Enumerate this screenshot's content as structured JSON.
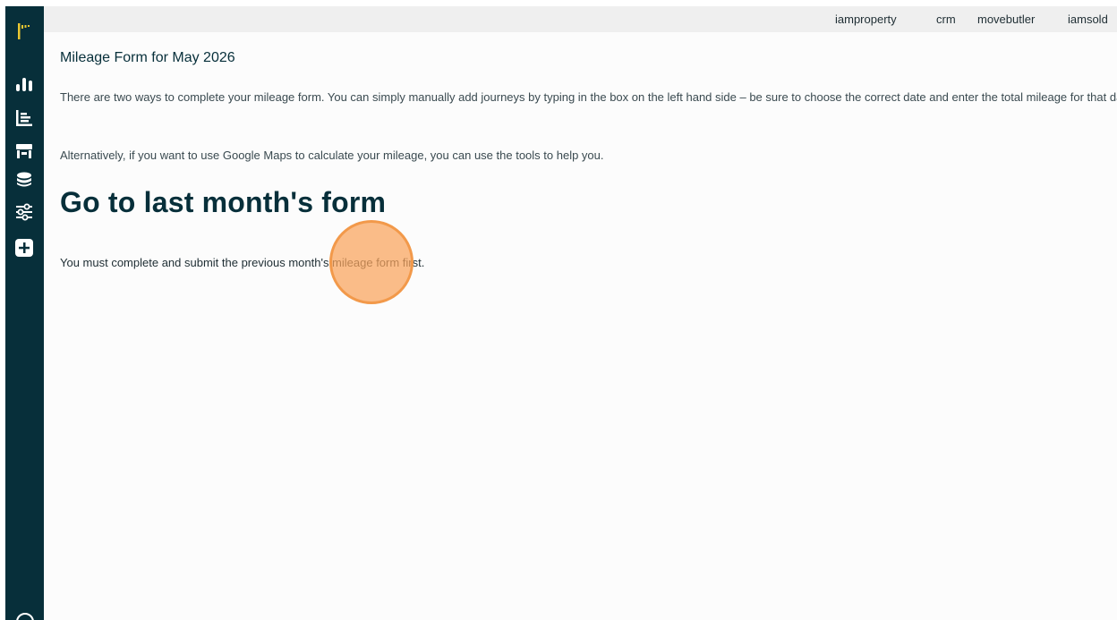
{
  "topnav": {
    "items": [
      "iamproperty",
      "crm",
      "movebutler",
      "iamsold"
    ]
  },
  "sidebar": {
    "icons": [
      "logo-icon",
      "bar-chart-icon",
      "list-chart-icon",
      "store-icon",
      "coins-icon",
      "sliders-icon",
      "add-icon",
      "help-icon"
    ]
  },
  "page": {
    "subtitle": "Mileage Form for May 2026",
    "intro_1": "There are two ways to complete your mileage form. You can simply manually add journeys by typing in the box on the left hand side – be sure to choose the correct date and enter the total mileage for that day.",
    "intro_2": "Alternatively, if you want to use Google Maps to calculate your mileage, you can use the tools to help you.",
    "heading": "Go to last month's form",
    "notice": "You must complete and submit the previous month's mileage form first."
  },
  "colors": {
    "sidebar": "#072f3a",
    "topbar": "#efefef",
    "accent": "#f2994a",
    "logo": "#e8c631"
  }
}
